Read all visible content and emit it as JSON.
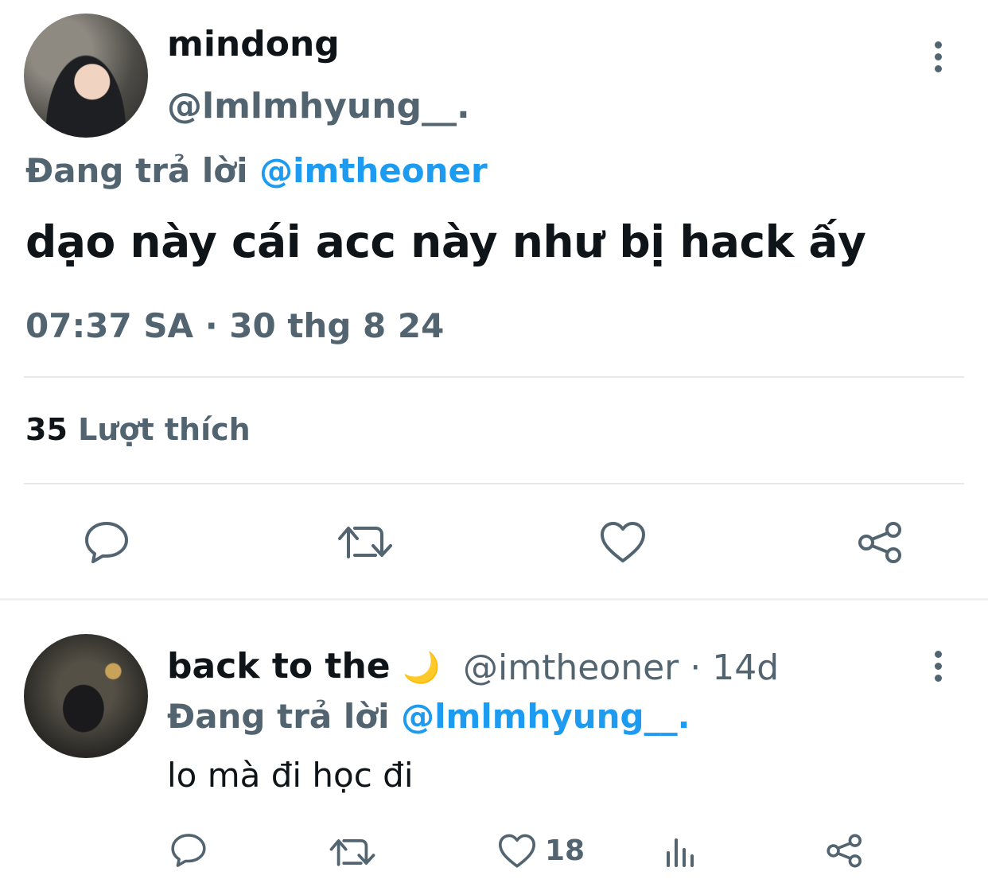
{
  "tweet": {
    "author_name": "mindong",
    "author_handle": "@lmlmhyung__.",
    "reply_prefix": "Đang trả lời",
    "reply_to": "@imtheoner",
    "text": "dạo này cái acc này như bị hack ấy",
    "timestamp": "07:37 SA · 30 thg 8 24",
    "likes_count": "35",
    "likes_label": "Lượt thích"
  },
  "reply": {
    "author_name": "back to the",
    "author_emoji": "🌙",
    "author_handle": "@imtheoner",
    "separator": "·",
    "age": "14d",
    "reply_prefix": "Đang trả lời",
    "reply_to": "@lmlmhyung__.",
    "text": "lo mà đi học đi",
    "like_count": "18"
  },
  "colors": {
    "accent": "#1d9bf0",
    "secondary_text": "#536471",
    "primary_text": "#0f1419"
  },
  "icons": [
    "more-icon",
    "comment-icon",
    "retweet-icon",
    "like-icon",
    "share-icon",
    "views-icon"
  ]
}
